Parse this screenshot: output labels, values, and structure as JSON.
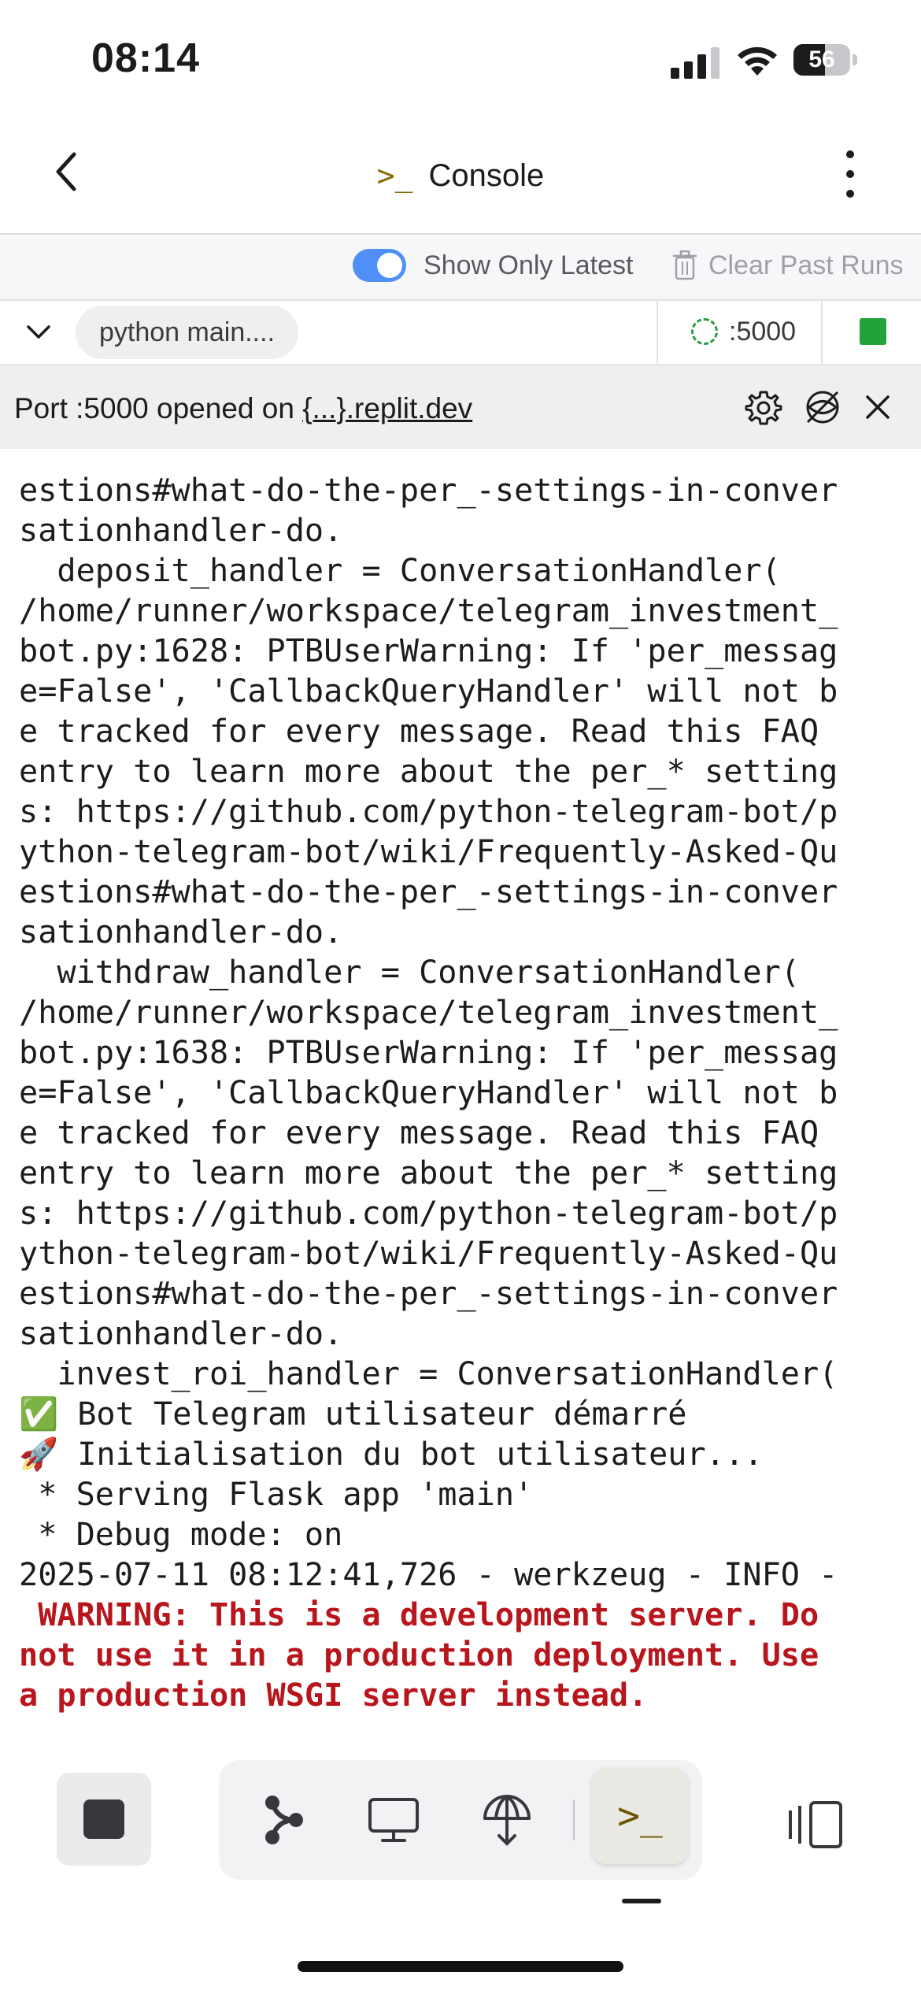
{
  "status_bar": {
    "time": "08:14",
    "battery": "56"
  },
  "header": {
    "title": "Console",
    "title_icon": ">_"
  },
  "toolbar": {
    "show_only_latest_label": "Show Only Latest",
    "show_only_latest_on": true,
    "clear_label": "Clear Past Runs"
  },
  "run": {
    "command": "python main....",
    "port": ":5000",
    "running": true
  },
  "notice": {
    "prefix": "Port :5000 opened on ",
    "link": "{...}.replit.dev"
  },
  "console": {
    "lines": [
      "estions#what-do-the-per_-settings-in-conver",
      "sationhandler-do.",
      "  deposit_handler = ConversationHandler(",
      "/home/runner/workspace/telegram_investment_",
      "bot.py:1628: PTBUserWarning: If 'per_messag",
      "e=False', 'CallbackQueryHandler' will not b",
      "e tracked for every message. Read this FAQ",
      "entry to learn more about the per_* setting",
      "s: https://github.com/python-telegram-bot/p",
      "ython-telegram-bot/wiki/Frequently-Asked-Qu",
      "estions#what-do-the-per_-settings-in-conver",
      "sationhandler-do.",
      "  withdraw_handler = ConversationHandler(",
      "/home/runner/workspace/telegram_investment_",
      "bot.py:1638: PTBUserWarning: If 'per_messag",
      "e=False', 'CallbackQueryHandler' will not b",
      "e tracked for every message. Read this FAQ",
      "entry to learn more about the per_* setting",
      "s: https://github.com/python-telegram-bot/p",
      "ython-telegram-bot/wiki/Frequently-Asked-Qu",
      "estions#what-do-the-per_-settings-in-conver",
      "sationhandler-do.",
      "  invest_roi_handler = ConversationHandler(",
      "✅ Bot Telegram utilisateur démarré",
      "🚀 Initialisation du bot utilisateur...",
      " * Serving Flask app 'main'",
      " * Debug mode: on",
      "2025-07-11 08:12:41,726 - werkzeug - INFO -"
    ],
    "warning_lines": [
      " WARNING: This is a development server. Do",
      "not use it in a production deployment. Use",
      "a production WSGI server instead."
    ]
  },
  "colors": {
    "accent": "#4f8ff7",
    "warning": "#b8161c",
    "running": "#22a33a"
  },
  "icons": [
    "back-icon",
    "kebab-icon",
    "trash-icon",
    "chevron-down-icon",
    "spinner-icon",
    "gear-icon",
    "preview-off-icon",
    "close-icon",
    "stop-icon",
    "git-icon",
    "monitor-icon",
    "deploy-icon",
    "terminal-icon",
    "layout-icon"
  ]
}
